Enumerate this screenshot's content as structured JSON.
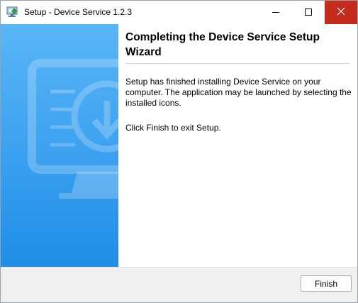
{
  "window": {
    "title": "Setup - Device Service 1.2.3",
    "icon": "setup-installer-icon",
    "controls": {
      "minimize": "minimize-icon",
      "maximize": "maximize-icon",
      "close": "close-icon"
    },
    "close_button_color": "#c42b1c"
  },
  "sidebar": {
    "illustration": "monitor-download-icon",
    "gradient_top": "#59b6f7",
    "gradient_bottom": "#1f8ee6"
  },
  "content": {
    "heading": "Completing the Device Service Setup Wizard",
    "paragraph1": "Setup has finished installing Device Service on your computer. The application may be launched by selecting the installed icons.",
    "paragraph2": "Click Finish to exit Setup."
  },
  "footer": {
    "finish_label": "Finish"
  }
}
